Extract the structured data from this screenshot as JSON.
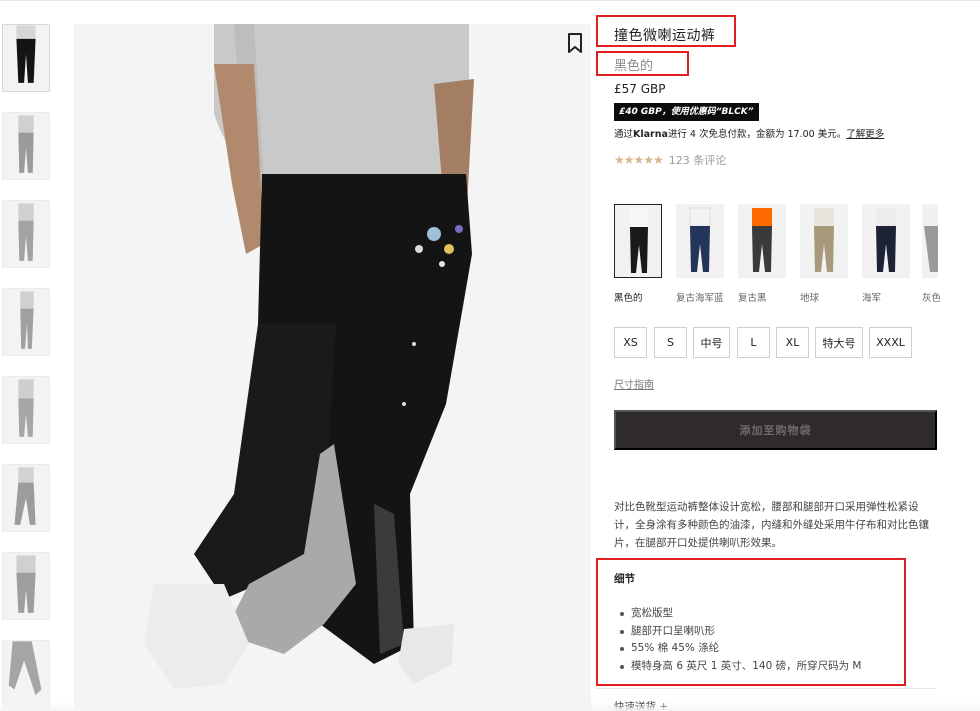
{
  "product": {
    "title": "撞色微喇运动裤",
    "color": "黑色的",
    "price": "£57 GBP",
    "promo": "£40 GBP，使用优惠码“BLCK”",
    "klarna": {
      "prefix": "通过",
      "brand": "Klarna",
      "middle": "进行 4 次免息付款，金额为 17.00 美元。",
      "link": "了解更多"
    },
    "rating": {
      "stars": "★★★★★",
      "reviews": "123 条评论"
    }
  },
  "swatches": [
    {
      "label": "黑色的",
      "top_color": "#f7f7f7",
      "leg_color": "#1a1a1a"
    },
    {
      "label": "复古海军蓝",
      "top_color": "#f2f2f2",
      "leg_color": "#24345a"
    },
    {
      "label": "复古黑",
      "top_color": "#ff6a00",
      "leg_color": "#3a3a3a"
    },
    {
      "label": "地球",
      "top_color": "#e8e4dd",
      "leg_color": "#a8987c"
    },
    {
      "label": "海军",
      "top_color": "#ececec",
      "leg_color": "#1d2336"
    },
    {
      "label": "灰色",
      "top_color": "#f0f0f0",
      "leg_color": "#9a9a9a"
    }
  ],
  "sizes": [
    "XS",
    "S",
    "中号",
    "L",
    "XL",
    "特大号",
    "XXXL"
  ],
  "size_guide": "尺寸指南",
  "add_to_bag": "添加至购物袋",
  "description": "对比色靴型运动裤整体设计宽松，腰部和腿部开口采用弹性松紧设计，全身涂有多种颜色的油漆，内缝和外缝处采用牛仔布和对比色镶片，在腿部开口处提供喇叭形效果。",
  "details": {
    "title": "细节",
    "items": [
      "宽松版型",
      "腿部开口呈喇叭形",
      "55% 棉 45% 涤纶",
      "模特身高 6 英尺 1 英寸、140 磅，所穿尺码为 M"
    ]
  },
  "delivery": "快速送货 +",
  "colors": {
    "annotation_red": "#e02020",
    "button_bg": "#2f2b2b",
    "star_color": "#d9b68c",
    "pants_black": "#141414",
    "hoodie_grey": "#c9c9c9"
  }
}
